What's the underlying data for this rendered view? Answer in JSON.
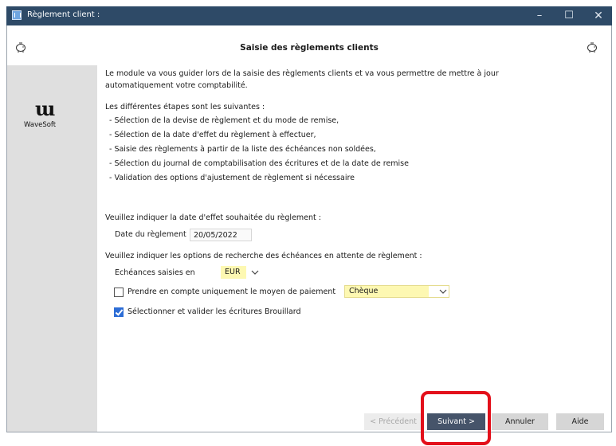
{
  "window": {
    "title": "Règlement client :"
  },
  "header": {
    "title": "Saisie des règlements clients"
  },
  "logo": {
    "text": "WaveSoft"
  },
  "intro": {
    "line1": "Le module va vous guider lors de la saisie des règlements clients et va vous permettre de mettre à jour",
    "line2": "automatiquement votre comptabilité."
  },
  "steps": {
    "heading": "Les différentes étapes sont les suivantes :",
    "items": [
      "- Sélection de la devise de règlement et du mode de remise,",
      "- Sélection de la date d'effet du règlement à effectuer,",
      "- Saisie des règlements à partir de la liste des échéances non soldées,",
      "- Sélection du journal de comptabilisation des écritures et de la date de remise",
      "- Validation des options d'ajustement de règlement si nécessaire"
    ]
  },
  "date_section": {
    "prompt": "Veuillez indiquer la date d'effet souhaitée du règlement :",
    "label": "Date du règlement",
    "value": "20/05/2022"
  },
  "search_section": {
    "prompt": "Veuillez indiquer les options de recherche des échéances en attente de règlement :",
    "currency_label": "Echéances saisies en",
    "currency_value": "EUR",
    "payment_checkbox_label": "Prendre en compte uniquement le moyen de paiement",
    "payment_checked": false,
    "payment_value": "Chèque",
    "brouillard_label": "Sélectionner et valider les écritures Brouillard",
    "brouillard_checked": true
  },
  "buttons": {
    "prev": "< Précédent",
    "next": "Suivant >",
    "cancel": "Annuler",
    "help": "Aide"
  },
  "colors": {
    "titlebar": "#2e4a67",
    "accent": "#2d6dd6",
    "highlight": "#e3101b",
    "field_yellow": "#fdf8b2"
  }
}
